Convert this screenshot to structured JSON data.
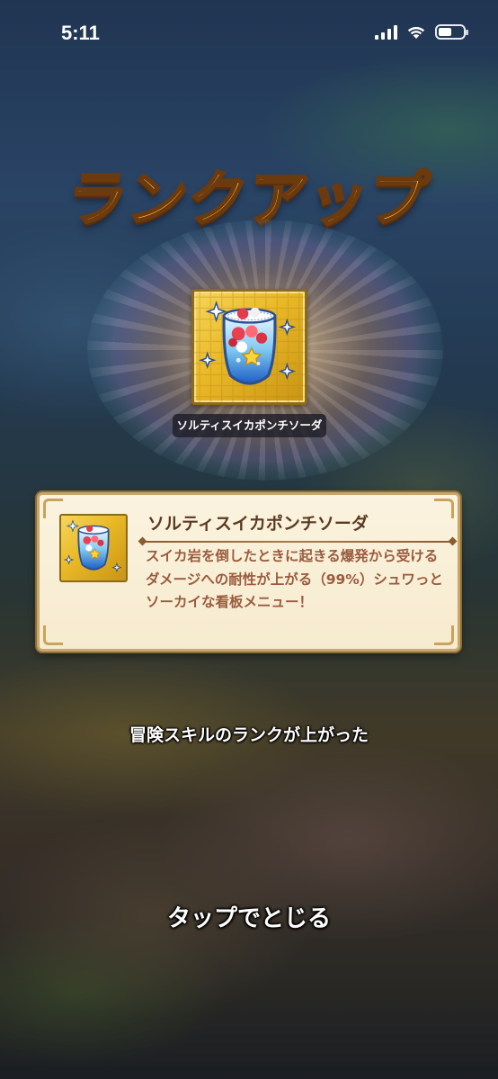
{
  "status_bar": {
    "time": "5:11",
    "icons": [
      "cellular-signal-icon",
      "wifi-icon",
      "battery-icon"
    ]
  },
  "rank_up": {
    "title": "ランクアップ",
    "skill_icon": "sparkling-soda-glass-icon",
    "skill_name_tag": "ソルティスイカポンチソーダ"
  },
  "info_card": {
    "title": "ソルティスイカポンチソーダ",
    "description": "スイカ岩を倒したときに起きる爆発から受けるダメージへの耐性が上がる（99%）シュワっとソーカイな看板メニュー！"
  },
  "message": "冒険スキルのランクが上がった",
  "tap_to_close": "タップでとじる",
  "colors": {
    "title_gold": "#ffc23a",
    "title_outline": "#6b3a0e",
    "card_bg": "#fbf3df",
    "card_border": "#c7a76c",
    "card_title": "#5b3a22",
    "card_text": "#9a5b3e",
    "icon_frame_gold": "#e9b826"
  }
}
